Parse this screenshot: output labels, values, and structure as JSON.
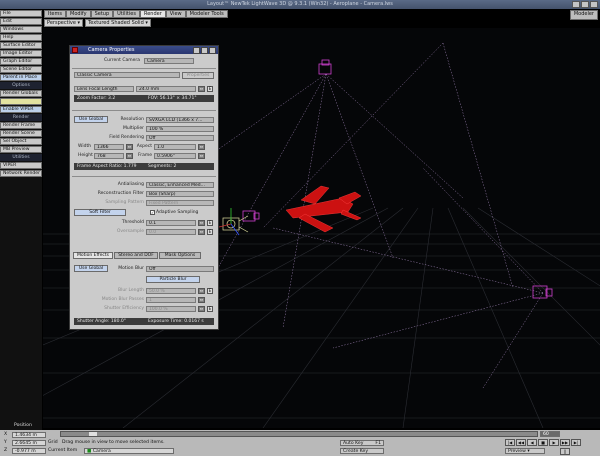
{
  "window": {
    "title": "Layout™ NewTek LightWave 3D @ 9.3.1 (Win32) - Aeroplane - Camera.lws"
  },
  "menu_tabs": [
    "Items",
    "Modify",
    "Setup",
    "Utilities",
    "Render",
    "View",
    "Modeler Tools"
  ],
  "active_tab": "Render",
  "modeler_label": "Modeler",
  "viewport": {
    "view": "Perspective",
    "shading": "Textured Shaded Solid"
  },
  "sidebar": {
    "top_buttons": [
      "File",
      "Edit",
      "Windows",
      "Help",
      "Surface Editor",
      "Image Editor",
      "Graph Editor",
      "Scene Editor",
      "Parent in Place"
    ],
    "options_head": "Options",
    "options_buttons": [
      "Render Globals",
      "Enable VIPER"
    ],
    "render_head": "Render",
    "render_buttons": [
      "Render Frame",
      "Render Scene",
      "Sel Object",
      "MB Preview"
    ],
    "utilities_head": "Utilities",
    "utilities_buttons": [
      "VIPER",
      "Network Render"
    ]
  },
  "camera_panel": {
    "title": "Camera Properties",
    "current_camera_label": "Current Camera",
    "current_camera": "Camera",
    "camera_type": "Classic Camera",
    "lens_mode": "Lens Focal Length",
    "lens_value": "24.0 mm",
    "zoom_factor": "Zoom Factor: 3.2",
    "fov": "FOV: 56.13° × 34.71°",
    "use_global_1": "Use Global",
    "resolution_label": "Resolution",
    "resolution": "SVXGA LCD (1366 x 7...",
    "multiplier_label": "Multiplier",
    "multiplier": "100 %",
    "field_rendering_label": "Field Rendering",
    "field_rendering": "Off",
    "width_label": "Width",
    "width": "1366",
    "aspect_label": "Aspect",
    "aspect": "1.0",
    "height_label": "Height",
    "height": "768",
    "frame_label": "Frame",
    "frame": "0.5906\"",
    "frame_aspect_ratio": "Frame Aspect Ratio: 1.779",
    "segments": "Segments: 2",
    "antialiasing_label": "Antialiasing",
    "antialiasing": "Classic, Enhanced Med...",
    "recon_filter_label": "Reconstruction Filter",
    "recon_filter": "Box (Sharp)",
    "sampling_pattern_label": "Sampling Pattern",
    "sampling_pattern": "Fixed Pattern",
    "soft_filter": "Soft Filter",
    "adaptive_sampling": "Adaptive Sampling",
    "threshold_label": "Threshold",
    "threshold": "0.1",
    "oversample_label": "Oversample",
    "oversample": "0.0",
    "tabs": [
      "Motion Effects",
      "Stereo and DOF",
      "Mask Options"
    ],
    "use_global_2": "Use Global",
    "motion_blur_label": "Motion Blur",
    "motion_blur": "Off",
    "particle_blur": "Particle Blur",
    "blur_length_label": "Blur Length",
    "blur_length": "50.0 %",
    "motion_blur_passes_label": "Motion Blur Passes",
    "motion_blur_passes": "1",
    "shutter_efficiency_label": "Shutter Efficiency",
    "shutter_efficiency": "100.0 %",
    "shutter_angle": "Shutter Angle: 180.0°",
    "exposure_time": "Exposure Time: 0.0167 s"
  },
  "timeline": {
    "position_label": "Position",
    "x_label": "X",
    "x_value": "1.4634 m",
    "y_label": "Y",
    "y_value": "2.6645 m",
    "z_label": "Z",
    "z_value": "-0.977 m",
    "grid_label": "Grid",
    "status": "Drag mouse in view to move selected items.",
    "current_item_label": "Current Item",
    "current_item": "Camera",
    "ticks": [
      "0",
      "10",
      "20",
      "30",
      "40",
      "50",
      "60"
    ],
    "end_label": "60",
    "auto_key": "Auto Key",
    "auto_key_value": "F1",
    "create_key": "Create Key",
    "preview": "Preview"
  },
  "colors": {
    "accent_blue": "#2a3670",
    "scene_red": "#cc1111",
    "camera_magenta": "#cc33cc"
  }
}
